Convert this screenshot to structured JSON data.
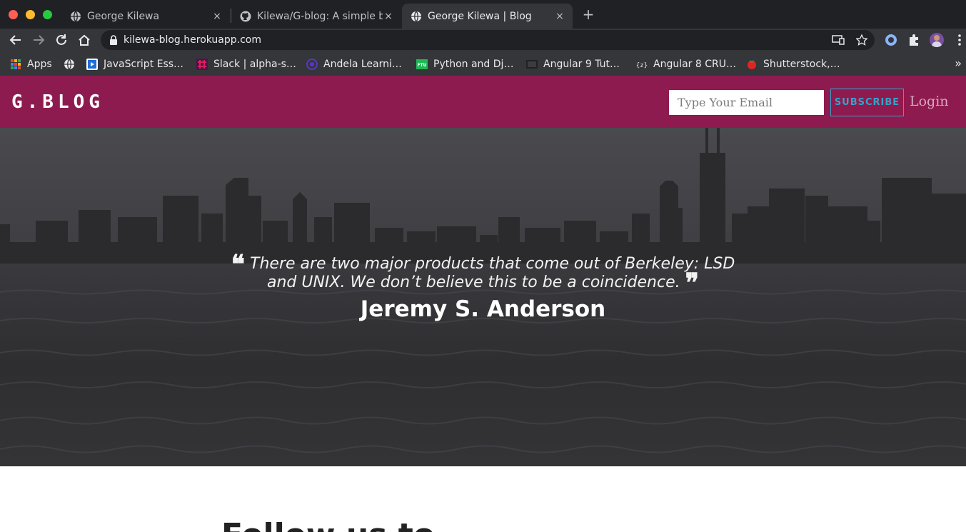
{
  "browser": {
    "tabs": [
      {
        "title": "George Kilewa",
        "icon": "globe-icon",
        "active": false
      },
      {
        "title": "Kilewa/G-blog: A simple bl",
        "icon": "github-icon",
        "active": false
      },
      {
        "title": "George Kilewa | Blog",
        "icon": "globe-icon",
        "active": true
      }
    ],
    "close_glyph": "×",
    "newtab_glyph": "+",
    "url": "kilewa-blog.herokuapp.com",
    "bookmarks": [
      {
        "label": "Apps",
        "icon": "apps-grid-icon"
      },
      {
        "label": "",
        "icon": "globe-icon"
      },
      {
        "label": "JavaScript Ess…",
        "icon": "video-icon"
      },
      {
        "label": "Slack | alpha-s…",
        "icon": "slack-icon"
      },
      {
        "label": "Andela Learni…",
        "icon": "andela-icon"
      },
      {
        "label": "Python and Dj…",
        "icon": "ftu-icon"
      },
      {
        "label": "Angular 9 Tut…",
        "icon": "film-icon"
      },
      {
        "label": "Angular 8 CRU…",
        "icon": "curly-braces-icon"
      },
      {
        "label": "Shutterstock,…",
        "icon": "tomato-icon"
      }
    ],
    "bookmarks_more": "»",
    "traffic_colors": [
      "#ff5f57",
      "#febc2e",
      "#28c840"
    ]
  },
  "site": {
    "logo": "G.BLOG",
    "email_placeholder": "Type Your Email",
    "subscribe_label": "SUBSCRIBE",
    "login_label": "Login",
    "nav_color": "#8e1b4f",
    "accent_color": "#35a3c9"
  },
  "hero": {
    "quote_open": "❝",
    "quote_text": "There are two major products that come out of Berkeley: LSD and UNIX. We don’t believe this to be a coincidence.",
    "quote_close": "❞",
    "author": "Jeremy S. Anderson"
  },
  "main": {
    "section_heading": "Follow us to"
  }
}
